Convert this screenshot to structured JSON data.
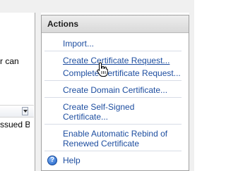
{
  "left_pane": {
    "text_fragment": "r can",
    "column_cell": "ssued B"
  },
  "actions": {
    "header": "Actions",
    "items": [
      {
        "label": "Import..."
      },
      {
        "label": "Create Certificate Request..."
      },
      {
        "label": "Complete Certificate Request..."
      },
      {
        "label": "Create Domain Certificate..."
      },
      {
        "label": "Create Self-Signed Certificate..."
      },
      {
        "label": "Enable Automatic Rebind of Renewed Certificate"
      }
    ],
    "help": {
      "label": "Help",
      "icon": "help-icon"
    }
  },
  "colors": {
    "link": "#1e4ea0",
    "header_bg": "#dcdcdc",
    "help_icon": "#1d5fc4"
  }
}
